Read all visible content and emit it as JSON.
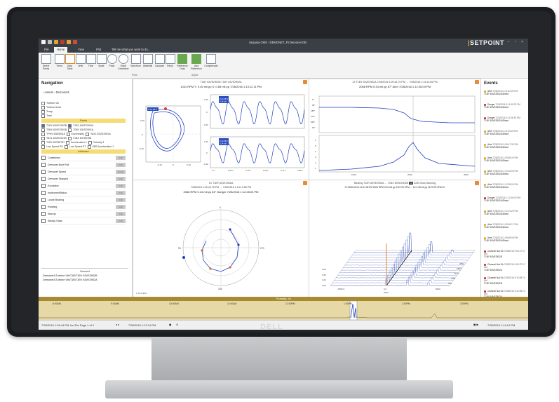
{
  "window": {
    "title": "Sequoia CMS - DEMONET_PI.Demonet DB",
    "brand_prefix": "|",
    "brand": "SETPOINT",
    "controls": "– ▫ ×"
  },
  "ribbon": {
    "tabs": [
      "File",
      "Home",
      "View",
      "Plot"
    ],
    "tell_me": "Tell me what you want to do...",
    "buttons": [
      "Select Points",
      "Trend",
      "Data Table",
      "Orbit",
      "Time",
      "Bode",
      "Polar",
      "Shaft Centerline",
      "Spectrum",
      "Waterfall",
      "Cascade",
      "Recip",
      "Reference Data",
      "Add Reference",
      "Compensate"
    ],
    "groups": [
      "Plots",
      "Adjust"
    ]
  },
  "navigation": {
    "title": "Navigation",
    "breadcrumb": "› Assets › Demonet1",
    "channels": [
      "Turbine Vib",
      "Turbine Axial",
      "Temp",
      "Time"
    ],
    "points_header": "Points",
    "points": [
      "T1BY 63VE2902B",
      "T1BY 63VE2902A",
      "T0BX 63VE2901B",
      "T0BY 63VE2901A",
      "TPHS 63005018",
      "Eccentricity",
      "TAXL 63VE2901A",
      "TAXL 63VE2901B",
      "T1BX 63T80788",
      "T1BY 63T80787",
      "Acceleration 1",
      "Velocity 3",
      "Low Speed RV",
      "Low Speed PT",
      "SEB Acceleration 1"
    ],
    "attributes_header": "Attributes",
    "attributes": [
      {
        "label": "Coastdown",
        "value": "0.00"
      },
      {
        "label": "Demonet Boot Roll",
        "value": "0.00"
      },
      {
        "label": "Demonet Speed",
        "value": "111.20"
      },
      {
        "label": "Demonet Stopped",
        "value": "0.00"
      },
      {
        "label": "Excitation",
        "value": "0.00"
      },
      {
        "label": "InstrumentStatus",
        "value": "0.00"
      },
      {
        "label": "Loose Bearing",
        "value": "0.00"
      },
      {
        "label": "Rubbing",
        "value": "0.00"
      },
      {
        "label": "Startup",
        "value": "0.00"
      },
      {
        "label": "Steady State",
        "value": "0.00"
      }
    ],
    "selected_label": "Selected",
    "selected": [
      "Demonet1\\Turbine Vib\\T1B\\T1BY 63VE2902B",
      "Demonet1\\Turbine Vib\\T1B\\T1BY 63VE2902A"
    ]
  },
  "orbit_plot": {
    "title": "T1BY 63VE2902B T1BY 63VE2902A",
    "subtitle": "1041 RPM   Y: 0.45 mil pp   X: 0.65 mil pp   7/28/2016 1:13:12.11 PM",
    "marker1": "0.13 28.0",
    "marker2": "0.14 mil",
    "y_ticks": [
      "0.16",
      "0",
      "-0.16"
    ],
    "x_ticks": [
      "-0.16",
      "0",
      "0.16"
    ],
    "wave_y": [
      "0.16",
      "0",
      "-0.10",
      "-0.16"
    ],
    "wave_x": [
      "0 s",
      "0.09 s",
      "0.19 s",
      "0.28 s",
      "0.37 s",
      "0.46 s"
    ],
    "zoom": "1.00"
  },
  "trend_plot": {
    "title": "1X T1BY 63VE2902A  7/28/2016 1:09:44.75 PM  →  7/28/2016 1:14:14.89 PM",
    "subtitle": "2068 RPM   0.33 mil pp 87° Alert   7/28/2016 1:12:28.04 PM",
    "phase_ticks": [
      "0°",
      "90°",
      "180°",
      "270°",
      "360°",
      "90°",
      "180°"
    ],
    "amp_ticks": [
      "6",
      "5",
      "4",
      "3",
      "2",
      "1",
      "0"
    ],
    "x_ticks": [
      "1000",
      "2000",
      "3000"
    ]
  },
  "polar_plot": {
    "title": "1X T1BY 63VE2902A",
    "range": "7/28/2016 1:09:44.75 PM  →  7/28/2016 1:14:14.89 PM",
    "subtitle": "2068 RPM   0.24 mil pp 64° Danger   7/28/2016 1:12:28.03 PM",
    "angles": [
      "0",
      "270",
      "180",
      "90"
    ],
    "footer": "1.70 mil/div"
  },
  "waterfall_plot": {
    "title": "Bearing T1BY 63VE2902A  →  T1BX 63VE2902B",
    "tag": "1X",
    "subtitle": "07:28:2016 01:12:21.06 PM   2061 RPM   0.03 mil pp  2107.09 CPM  →  1X  2.28 mil pp 2107.59 CPM 1X",
    "lines": "3200 lines  Hanning",
    "rpm_ticks": [
      "2894",
      "2363",
      "1772",
      "1181",
      "591",
      "0"
    ],
    "amp_ticks": [
      "2.00",
      "1.50",
      "1.00",
      "0.50",
      "0.00"
    ],
    "x_ticks": [
      "-5000 0",
      "0.0",
      "5000"
    ],
    "x_label": "CPM"
  },
  "events": {
    "title": "Events",
    "items": [
      {
        "status": "Alert",
        "time": "7/28/2016 3:11:52:00 PM",
        "point": "T1BY 63VE2902A\\Direct",
        "color": "#e0a800"
      },
      {
        "status": "Danger",
        "time": "7/28/2016 3:11:09:22 PM",
        "point": "T1BY 63VE2902A\\Direct",
        "color": "#d21f1f"
      },
      {
        "status": "Danger",
        "time": "7/28/2016 3:11:08:52 PM",
        "point": "T1BY 63VE2902A\\Direct",
        "color": "#d21f1f"
      },
      {
        "status": "Alert",
        "time": "7/28/2016 3:11:05:26 PM",
        "point": "T1BY 63VE2902A\\Direct",
        "color": "#e0a800"
      },
      {
        "status": "Alert",
        "time": "7/28/2016 3:09:47:32 PM",
        "point": "T1BY 63VE2902A\\Direct",
        "color": "#e0a800"
      },
      {
        "status": "Alert",
        "time": "7/28/2016 1:09:59:24 PM",
        "point": "T1BY 63VE2902A\\Direct",
        "color": "#e0a800"
      },
      {
        "status": "Alert",
        "time": "7/28/2016 1:12:32:00 PM",
        "point": "T1BY 63VE2902A\\Direct",
        "color": "#e0a800"
      },
      {
        "status": "Alert",
        "time": "7/28/2016 1:12:28:00 PM",
        "point": "T1BY 63VE2902A\\Direct",
        "color": "#e0a800"
      },
      {
        "status": "Danger",
        "time": "7/28/2016 1:12:28:19 PM",
        "point": "T1BY 63VE2902A\\Direct",
        "color": "#d21f1f"
      },
      {
        "status": "Alert",
        "time": "7/28/2016 1:12:19:29 PM",
        "point": "T1BY 63VE2902A\\Direct",
        "color": "#e0a800"
      },
      {
        "status": "Alert",
        "time": "7/28/2016 1:09:50:17 PM",
        "point": "T1BY 63VE2902A\\Direct",
        "color": "#e0a800"
      },
      {
        "status": "Alert",
        "time": "7/28/2016 1:08:59:09 PM",
        "point": "T1BY 63VE2902A\\Direct",
        "color": "#e0a800"
      },
      {
        "status": "Channel Not Ok",
        "time": "7/28/2016 9:09:27:17 AM",
        "point": "T1BY 63VE2902B",
        "color": "#d21f1f"
      },
      {
        "status": "Channel Not Ok",
        "time": "7/28/2016 9:09:27:17 AM",
        "point": "T1BY 63VE2902A",
        "color": "#d21f1f"
      },
      {
        "status": "Channel Not Ok",
        "time": "7/28/2016 9:10:08:74 AM",
        "point": "T1BY 63VE2902B",
        "color": "#d21f1f"
      },
      {
        "status": "Channel Not Ok",
        "time": "7/28/2016 9:10:08:74 AM",
        "point": "T1BY 63VE2902A",
        "color": "#d21f1f"
      }
    ]
  },
  "timeline": {
    "header": "Thursday, Jul",
    "ticks": [
      "8:00AM",
      "9:00AM",
      "10:00AM",
      "11:00AM",
      "12:00PM",
      "1:00PM",
      "2:00PM",
      "3:00PM"
    ]
  },
  "statusbar": {
    "left": "7/28/2016 1:09:44 PM  4m 30s   Page 1 of 1",
    "mid": "7/28/2016 1:12:14 PM",
    "right": "7/28/2016 1:14:14 PM"
  },
  "monitor_brand": "DELL"
}
